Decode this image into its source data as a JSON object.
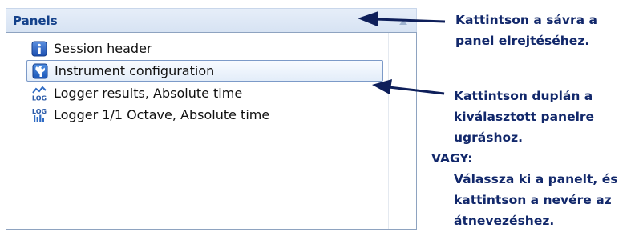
{
  "panels": {
    "title": "Panels",
    "items": [
      {
        "label": "Session header",
        "icon": "info-icon",
        "selected": false
      },
      {
        "label": "Instrument configuration",
        "icon": "wrench-icon",
        "selected": true
      },
      {
        "label": "Logger results, Absolute time",
        "icon": "log-results-icon",
        "selected": false
      },
      {
        "label": "Logger 1/1 Octave, Absolute time",
        "icon": "log-octave-icon",
        "selected": false
      }
    ]
  },
  "annotations": {
    "collapse_hint": "Kattintson a sávra a\npanel elrejtéséhez.",
    "double_click_hint": "Kattintson duplán a\nkiválasztott panelre\nugráshoz.",
    "or_label": "VAGY:",
    "rename_hint": "Válassza ki a panelt, és\nkattintson a nevére az\nátnevezéshez."
  },
  "colors": {
    "annotation_text": "#12286b",
    "header_text": "#15428b",
    "selection_border": "#7c9ac8"
  }
}
